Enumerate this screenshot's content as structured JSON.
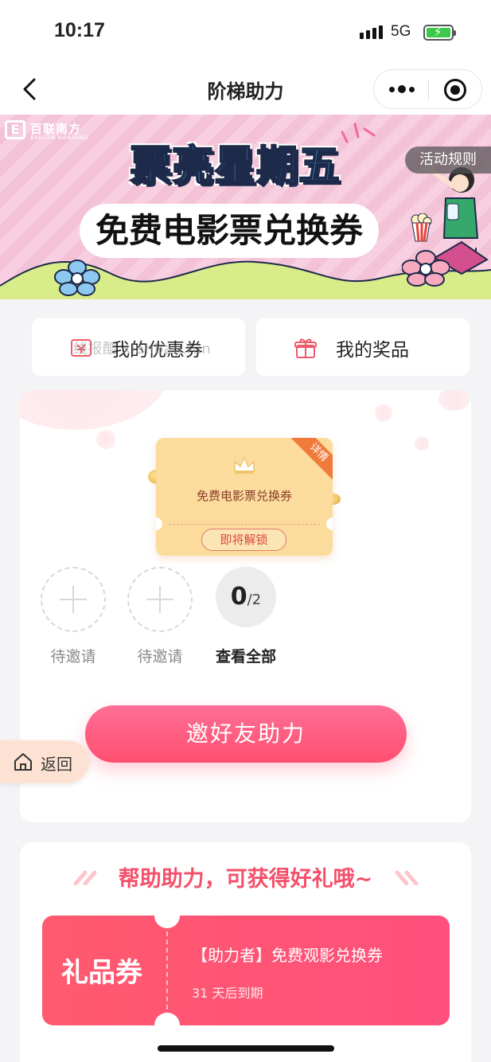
{
  "status_bar": {
    "time": "10:17",
    "network": "5G"
  },
  "nav": {
    "title": "阶梯助力"
  },
  "banner": {
    "brand_cn": "百联南方",
    "brand_en": "BAILIAN NANFANG",
    "title": "票亮星期五",
    "subtitle": "免费电影票兑换券",
    "rules_label": "活动规则"
  },
  "quick_links": {
    "coupons_label": "我的优惠券",
    "prizes_label": "我的奖品",
    "watermark": "线报酷 xianbao.fun"
  },
  "reward": {
    "detail_label": "详情",
    "voucher_name": "免费电影票兑换券",
    "unlock_label": "即将解锁"
  },
  "invites": {
    "slots": [
      {
        "label": "待邀请"
      },
      {
        "label": "待邀请"
      }
    ],
    "progress_current": "0",
    "progress_total": "/2",
    "view_all_label": "查看全部"
  },
  "cta": {
    "invite_label": "邀好友助力"
  },
  "floating": {
    "return_label": "返回"
  },
  "help_section": {
    "title": "帮助助力，可获得好礼哦~",
    "coupon": {
      "type_label": "礼品券",
      "name": "【助力者】免费观影兑换券",
      "expiry": "31 天后到期"
    }
  },
  "colors": {
    "primary": "#ff4f6f",
    "voucher_bg": "#fbdc9d",
    "title_blue": "#43b6ec"
  }
}
